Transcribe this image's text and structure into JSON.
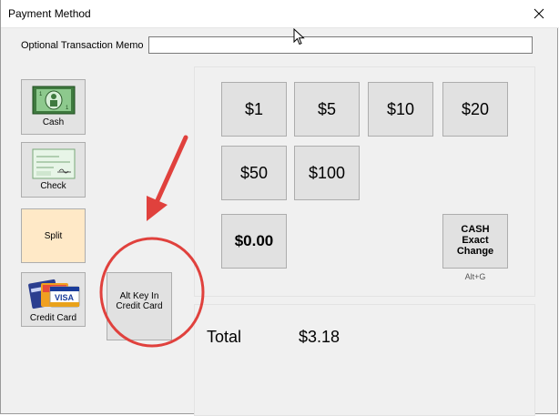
{
  "window": {
    "title": "Payment Method"
  },
  "memo": {
    "label": "Optional Transaction Memo",
    "value": ""
  },
  "methods": {
    "cash": "Cash",
    "check": "Check",
    "split": "Split",
    "credit_card": "Credit Card",
    "alt_key_line1": "Alt Key In",
    "alt_key_line2": "Credit Card"
  },
  "amounts": [
    "$1",
    "$5",
    "$10",
    "$20",
    "$50",
    "$100"
  ],
  "tendered": "$0.00",
  "cash_exact": {
    "line1": "CASH",
    "line2": "Exact",
    "line3": "Change",
    "shortcut": "Alt+G"
  },
  "total": {
    "label": "Total",
    "value": "$3.18"
  },
  "colors": {
    "split_bg": "#ffe9c7",
    "annotation_red": "#e0413d"
  }
}
